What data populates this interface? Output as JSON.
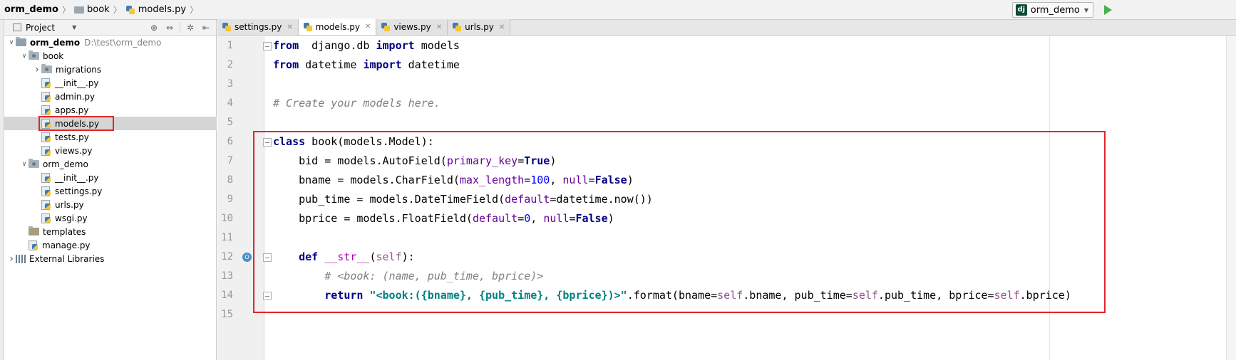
{
  "breadcrumb": {
    "project": "orm_demo",
    "folder": "book",
    "file": "models.py"
  },
  "run_config": {
    "label": "orm_demo"
  },
  "project_panel": {
    "title": "Project",
    "tree": [
      {
        "label": "orm_demo",
        "path": "D:\\test\\orm_demo",
        "bold": true,
        "indent": 0,
        "arrow": "down",
        "icon": "root"
      },
      {
        "label": "book",
        "indent": 1,
        "arrow": "down",
        "icon": "package"
      },
      {
        "label": "migrations",
        "indent": 2,
        "arrow": "right",
        "icon": "package"
      },
      {
        "label": "__init__.py",
        "indent": 2,
        "icon": "py"
      },
      {
        "label": "admin.py",
        "indent": 2,
        "icon": "py"
      },
      {
        "label": "apps.py",
        "indent": 2,
        "icon": "py"
      },
      {
        "label": "models.py",
        "indent": 2,
        "icon": "py",
        "selected": true,
        "highlighted": true
      },
      {
        "label": "tests.py",
        "indent": 2,
        "icon": "py"
      },
      {
        "label": "views.py",
        "indent": 2,
        "icon": "py"
      },
      {
        "label": "orm_demo",
        "indent": 1,
        "arrow": "down",
        "icon": "package"
      },
      {
        "label": "__init__.py",
        "indent": 2,
        "icon": "py"
      },
      {
        "label": "settings.py",
        "indent": 2,
        "icon": "py"
      },
      {
        "label": "urls.py",
        "indent": 2,
        "icon": "py"
      },
      {
        "label": "wsgi.py",
        "indent": 2,
        "icon": "py"
      },
      {
        "label": "templates",
        "indent": 1,
        "icon": "templates"
      },
      {
        "label": "manage.py",
        "indent": 1,
        "icon": "py"
      },
      {
        "label": "External Libraries",
        "indent": 0,
        "arrow": "right",
        "icon": "libraries"
      }
    ]
  },
  "tabs": [
    {
      "label": "settings.py",
      "active": false
    },
    {
      "label": "models.py",
      "active": true
    },
    {
      "label": "views.py",
      "active": false
    },
    {
      "label": "urls.py",
      "active": false
    }
  ],
  "editor": {
    "override_marker": "O",
    "lines": [
      [
        [
          "kw",
          "from"
        ],
        [
          "",
          "  django.db "
        ],
        [
          "kw",
          "import"
        ],
        [
          "",
          " models"
        ]
      ],
      [
        [
          "kw",
          "from"
        ],
        [
          "",
          " datetime "
        ],
        [
          "kw",
          "import"
        ],
        [
          "",
          " datetime"
        ]
      ],
      [],
      [
        [
          "cm",
          "# Create your models here."
        ]
      ],
      [],
      [
        [
          "kw",
          "class"
        ],
        [
          "",
          " book(models.Model):"
        ]
      ],
      [
        [
          "",
          "    bid = models.AutoField("
        ],
        [
          "kwarg",
          "primary_key"
        ],
        [
          "",
          "="
        ],
        [
          "kw",
          "True"
        ],
        [
          "",
          ")"
        ]
      ],
      [
        [
          "",
          "    bname = models.CharField("
        ],
        [
          "kwarg",
          "max_length"
        ],
        [
          "",
          "="
        ],
        [
          "num",
          "100"
        ],
        [
          "",
          ", "
        ],
        [
          "kwarg",
          "null"
        ],
        [
          "",
          "="
        ],
        [
          "kw",
          "False"
        ],
        [
          "",
          ")"
        ]
      ],
      [
        [
          "",
          "    pub_time = models.DateTimeField("
        ],
        [
          "kwarg",
          "default"
        ],
        [
          "",
          "=datetime.now())"
        ]
      ],
      [
        [
          "",
          "    bprice = models.FloatField("
        ],
        [
          "kwarg",
          "default"
        ],
        [
          "",
          "="
        ],
        [
          "num",
          "0"
        ],
        [
          "",
          ", "
        ],
        [
          "kwarg",
          "null"
        ],
        [
          "",
          "="
        ],
        [
          "kw",
          "False"
        ],
        [
          "",
          ")"
        ]
      ],
      [],
      [
        [
          "",
          "    "
        ],
        [
          "kw",
          "def"
        ],
        [
          "",
          " "
        ],
        [
          "magic",
          "__str__"
        ],
        [
          "",
          "("
        ],
        [
          "selfk",
          "self"
        ],
        [
          "",
          "):"
        ]
      ],
      [
        [
          "",
          "        "
        ],
        [
          "cm",
          "# <book: (name, pub_time, bprice)>"
        ]
      ],
      [
        [
          "",
          "        "
        ],
        [
          "kw",
          "return"
        ],
        [
          "",
          " "
        ],
        [
          "str",
          "\"<book:({bname}, {pub_time}, {bprice})>\""
        ],
        [
          "",
          ".format(bname="
        ],
        [
          "selfk",
          "self"
        ],
        [
          "",
          ".bname, pub_time="
        ],
        [
          "selfk",
          "self"
        ],
        [
          "",
          ".pub_time, bprice="
        ],
        [
          "selfk",
          "self"
        ],
        [
          "",
          ".bprice)"
        ]
      ],
      []
    ]
  },
  "colors": {
    "highlight_box": "#e0262b",
    "keyword": "#000080",
    "string": "#008080",
    "comment": "#808080",
    "kwarg": "#660099",
    "number": "#0000ff"
  }
}
